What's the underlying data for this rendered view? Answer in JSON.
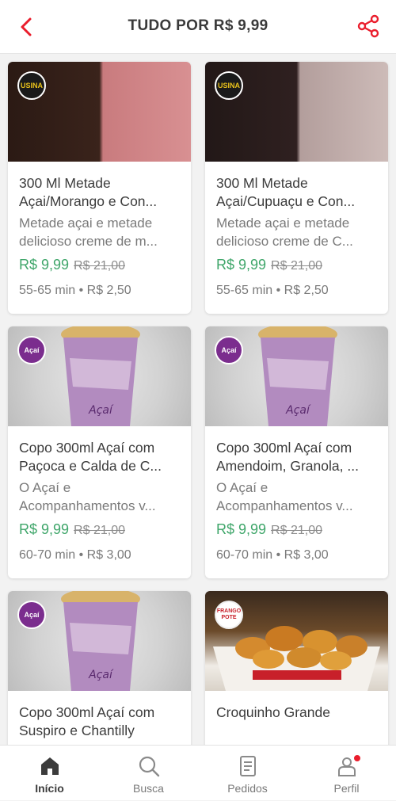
{
  "header": {
    "title": "TUDO POR R$ 9,99",
    "back_icon": "chevron-left-icon",
    "share_icon": "share-icon",
    "accent": "#ea1d2c"
  },
  "products": [
    {
      "name": "300 Ml Metade Açai/Morango e Con...",
      "description": "Metade açai e metade delicioso creme de m...",
      "price": "R$ 9,99",
      "old_price": "R$ 21,00",
      "meta": "55-65 min • R$ 2,50",
      "store_logo": "USINA"
    },
    {
      "name": "300 Ml Metade Açai/Cupuaçu e Con...",
      "description": "Metade açai e metade delicioso creme de C...",
      "price": "R$ 9,99",
      "old_price": "R$ 21,00",
      "meta": "55-65 min • R$ 2,50",
      "store_logo": "USINA"
    },
    {
      "name": "Copo 300ml Açaí com Paçoca e Calda de C...",
      "description": "O Açaí e Acompanhamentos v...",
      "price": "R$ 9,99",
      "old_price": "R$ 21,00",
      "meta": "60-70 min • R$ 3,00",
      "store_logo": "Açaí"
    },
    {
      "name": "Copo 300ml Açaí com Amendoim, Granola, ...",
      "description": "O Açaí e Acompanhamentos v...",
      "price": "R$ 9,99",
      "old_price": "R$ 21,00",
      "meta": "60-70 min • R$ 3,00",
      "store_logo": "Açaí"
    },
    {
      "name": "Copo 300ml Açaí com Suspiro e Chantilly",
      "store_logo": "Açaí"
    },
    {
      "name": "Croquinho Grande",
      "store_logo": "FRANGO POTE"
    }
  ],
  "tabbar": {
    "items": [
      {
        "label": "Início",
        "icon": "home-icon",
        "active": true
      },
      {
        "label": "Busca",
        "icon": "search-icon"
      },
      {
        "label": "Pedidos",
        "icon": "orders-icon"
      },
      {
        "label": "Perfil",
        "icon": "profile-icon"
      }
    ]
  },
  "colors": {
    "price": "#3fa66a",
    "text": "#3c3c3c",
    "muted": "#7a7a7a",
    "brand_red": "#ea1d2c",
    "acai_purple": "#7b2d8e"
  }
}
